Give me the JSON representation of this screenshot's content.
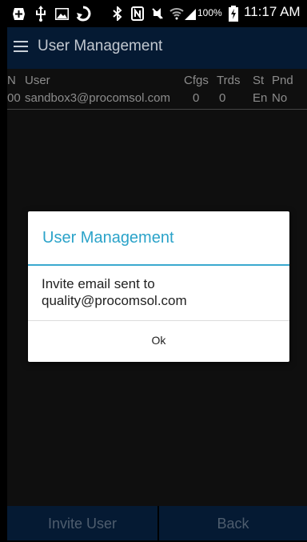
{
  "status_bar": {
    "icons": [
      "add-icon",
      "usb-icon",
      "image-icon",
      "sync-icon",
      "bluetooth-icon",
      "nfc-icon",
      "mute-icon",
      "wifi-icon",
      "signal-icon",
      "battery-charging-icon"
    ],
    "battery_percent": "100%",
    "time": "11:17 AM"
  },
  "action_bar": {
    "title": "User Management",
    "menu_icon": "menu-icon",
    "background": "#051a33"
  },
  "table": {
    "columns": [
      "N",
      "User",
      "Cfgs",
      "Trds",
      "St",
      "Pnd"
    ],
    "rows": [
      [
        "00",
        "sandbox3@procomsol.com",
        "0",
        "0",
        "En",
        "No"
      ]
    ]
  },
  "dialog": {
    "title": "User Management",
    "message_line1": "Invite email sent to",
    "message_line2": "quality@procomsol.com",
    "ok_label": "Ok",
    "accent": "#3aa9cf"
  },
  "bottom_bar": {
    "invite_label": "Invite User",
    "back_label": "Back"
  }
}
